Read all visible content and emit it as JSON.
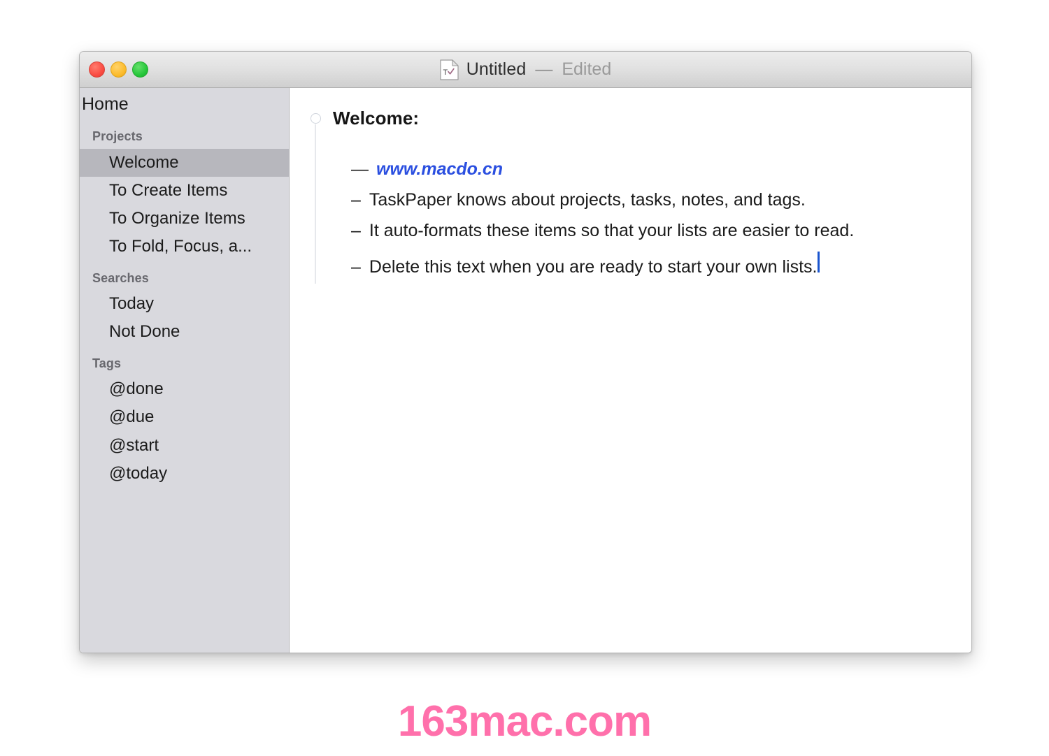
{
  "window": {
    "title": "Untitled",
    "separator": "—",
    "state": "Edited",
    "doc_icon": "taskpaper-document-icon",
    "controls": {
      "close": "close-button",
      "minimize": "minimize-button",
      "maximize": "maximize-button"
    }
  },
  "colors": {
    "sidebar_bg": "#d9d9de",
    "sidebar_selected": "#b7b7bd",
    "divider": "#b0b0b5",
    "titlebar_top": "#ececec",
    "titlebar_bottom": "#cfcfcf",
    "link": "#2b4fe0",
    "caret": "#1a55cf",
    "watermark": "#ff70ab",
    "traffic_close": "#fa4b42",
    "traffic_minimize": "#fcbb2b",
    "traffic_maximize": "#25c63a"
  },
  "sidebar": {
    "home_label": "Home",
    "sections": [
      {
        "title": "Projects",
        "items": [
          {
            "label": "Welcome",
            "selected": true
          },
          {
            "label": "To Create Items",
            "selected": false
          },
          {
            "label": "To Organize Items",
            "selected": false
          },
          {
            "label": "To Fold, Focus, a...",
            "selected": false
          }
        ]
      },
      {
        "title": "Searches",
        "items": [
          {
            "label": "Today",
            "selected": false
          },
          {
            "label": "Not Done",
            "selected": false
          }
        ]
      },
      {
        "title": "Tags",
        "items": [
          {
            "label": "@done",
            "selected": false
          },
          {
            "label": "@due",
            "selected": false
          },
          {
            "label": "@start",
            "selected": false
          },
          {
            "label": "@today",
            "selected": false
          }
        ]
      }
    ]
  },
  "document": {
    "project_title": "Welcome:",
    "items": [
      {
        "bullet": "—",
        "text": "www.macdo.cn",
        "is_link": true,
        "has_caret": false
      },
      {
        "bullet": "–",
        "text": "TaskPaper knows about projects, tasks, notes, and tags.",
        "is_link": false,
        "has_caret": false
      },
      {
        "bullet": "–",
        "text": "It auto-formats these items so that your lists are easier to read.",
        "is_link": false,
        "has_caret": false
      },
      {
        "bullet": "–",
        "text": "Delete this text when you are ready to start your own lists.",
        "is_link": false,
        "has_caret": true
      }
    ]
  },
  "watermark": {
    "text": "163mac.com"
  }
}
